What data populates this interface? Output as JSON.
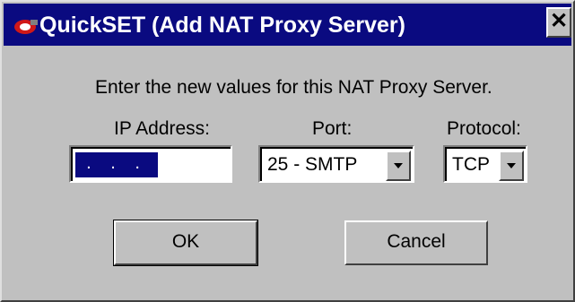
{
  "window": {
    "title": "QuickSET (Add NAT Proxy Server)",
    "close_label": "✕"
  },
  "form": {
    "instructions": "Enter the new values for this NAT Proxy Server.",
    "ip_label": "IP Address:",
    "ip_value": ". . .",
    "port_label": "Port:",
    "port_value": "25 - SMTP",
    "protocol_label": "Protocol:",
    "protocol_value": "TCP"
  },
  "buttons": {
    "ok": "OK",
    "cancel": "Cancel"
  },
  "icons": {
    "app": "quickset-app-icon",
    "close": "close-icon",
    "dropdown": "chevron-down-icon"
  },
  "colors": {
    "titlebar": "#0a0a80",
    "face": "#c0c0c0"
  }
}
